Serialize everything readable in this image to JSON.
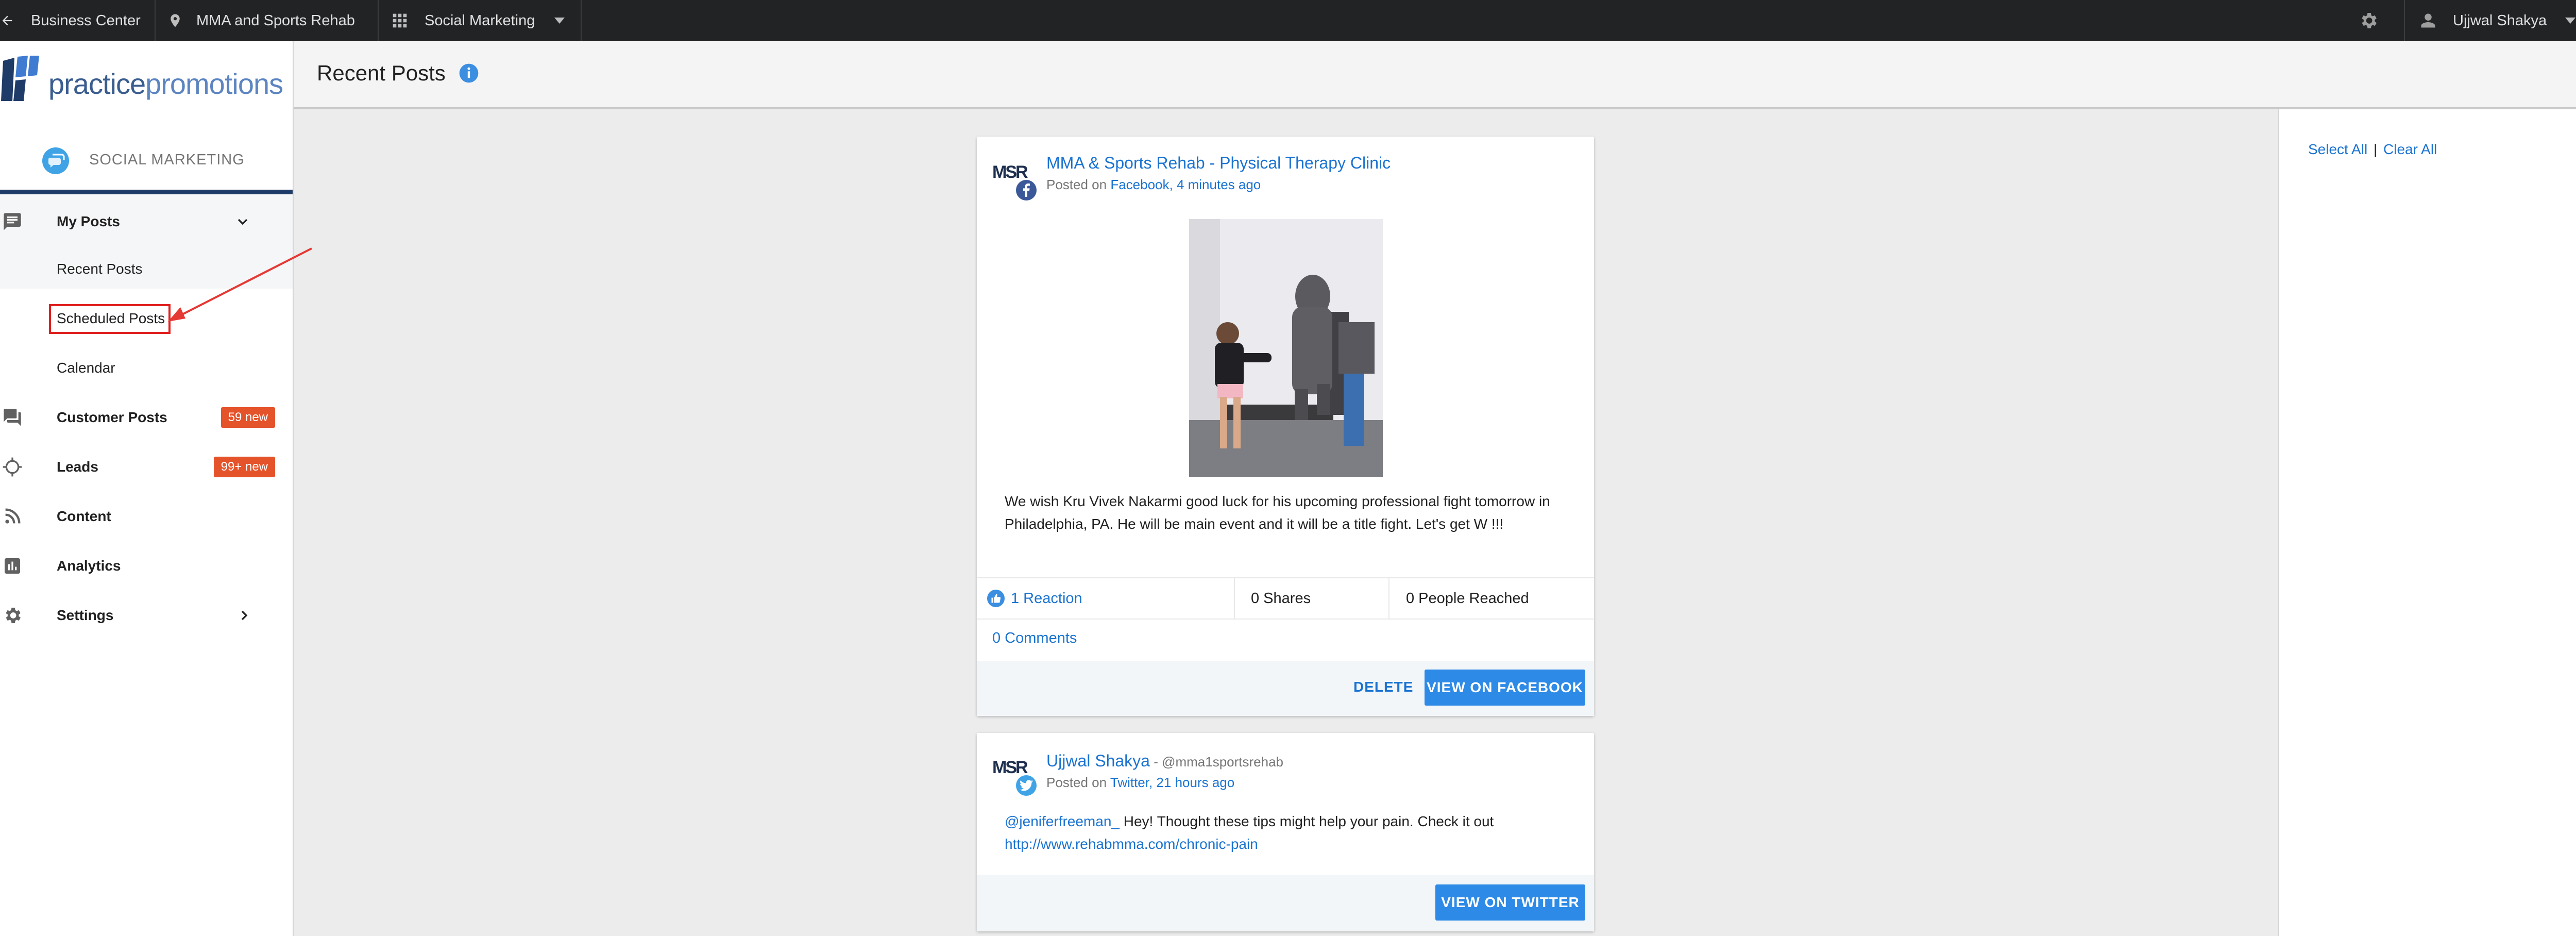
{
  "topbar": {
    "business_center": "Business Center",
    "location": "MMA and Sports Rehab",
    "app": "Social Marketing",
    "user": "Ujjwal Shakya"
  },
  "sidebar": {
    "brand_a": "practice",
    "brand_b": "promotions",
    "section": "SOCIAL MARKETING",
    "nav": {
      "my_posts": "My Posts",
      "recent_posts": "Recent Posts",
      "scheduled_posts": "Scheduled Posts",
      "calendar": "Calendar",
      "customer_posts": "Customer Posts",
      "customer_posts_badge": "59 new",
      "leads": "Leads",
      "leads_badge": "99+ new",
      "content": "Content",
      "analytics": "Analytics",
      "settings": "Settings"
    }
  },
  "header": {
    "title": "Recent Posts"
  },
  "right_panel": {
    "select_all": "Select All",
    "separator": "|",
    "clear_all": "Clear All"
  },
  "posts": [
    {
      "author": "MMA & Sports Rehab - Physical Therapy Clinic",
      "avatar": "MSR",
      "meta_prefix": "Posted on ",
      "meta_link": "Facebook, 4 minutes ago",
      "body": "We wish Kru Vivek Nakarmi good luck for his upcoming professional fight tomorrow in Philadelphia, PA. He will be main event and it will be a title fight. Let's get W !!!",
      "reactions": "1 Reaction",
      "shares": "0 Shares",
      "reached": "0 People Reached",
      "comments": "0 Comments",
      "delete": "DELETE",
      "view": "VIEW ON FACEBOOK"
    },
    {
      "author": "Ujjwal Shakya",
      "handle": " - @mma1sportsrehab",
      "avatar": "MSR",
      "meta_prefix": "Posted on ",
      "meta_link": "Twitter, 21 hours ago",
      "mention": "@jeniferfreeman_",
      "body": " Hey! Thought these tips might help your pain. Check it out",
      "url": "http://www.rehabmma.com/chronic-pain",
      "view": "VIEW ON TWITTER"
    }
  ],
  "colors": {
    "accent": "#2d8ae6",
    "link": "#1a73d1",
    "badge": "#e5532b",
    "topbar": "#212325",
    "highlight": "#e02020"
  }
}
